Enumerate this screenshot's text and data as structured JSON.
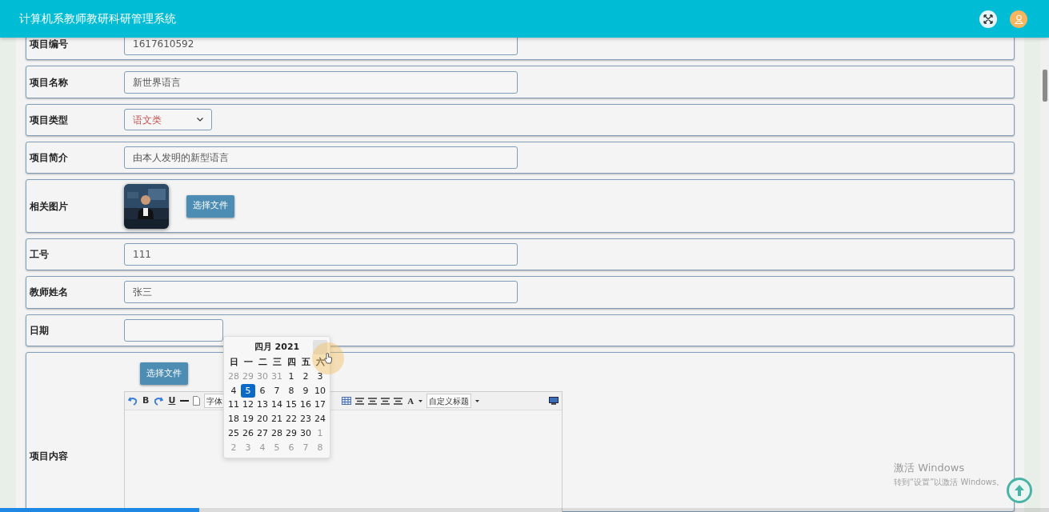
{
  "header": {
    "title": "计算机系教师教研科研管理系统"
  },
  "form": [
    {
      "kind": "text",
      "label": "项目编号",
      "value": "1617610592"
    },
    {
      "kind": "text",
      "label": "项目名称",
      "value": "新世界语言"
    },
    {
      "kind": "select",
      "label": "项目类型",
      "value": "语文类"
    },
    {
      "kind": "text",
      "label": "项目简介",
      "value": "由本人发明的新型语言"
    },
    {
      "label": "相关图片",
      "button": "选择文件"
    },
    {
      "kind": "text",
      "label": "工号",
      "value": "111"
    },
    {
      "kind": "text",
      "label": "教师姓名",
      "value": "张三"
    },
    {
      "kind": "date",
      "label": "日期",
      "calendar": {
        "title": "四月 2021",
        "weekdays": [
          "日",
          "一",
          "二",
          "三",
          "四",
          "五",
          "六"
        ],
        "weeks": [
          [
            {
              "day": "28",
              "muted": true,
              "selected": false
            },
            {
              "day": "29",
              "muted": true,
              "selected": false
            },
            {
              "day": "30",
              "muted": true,
              "selected": false
            },
            {
              "day": "31",
              "muted": true,
              "selected": false
            },
            {
              "day": "1",
              "muted": false,
              "selected": false
            },
            {
              "day": "2",
              "muted": false,
              "selected": false
            },
            {
              "day": "3",
              "muted": false,
              "selected": false
            }
          ],
          [
            {
              "day": "4",
              "muted": false,
              "selected": false
            },
            {
              "day": "5",
              "muted": false,
              "selected": true
            },
            {
              "day": "6",
              "muted": false,
              "selected": false
            },
            {
              "day": "7",
              "muted": false,
              "selected": false
            },
            {
              "day": "8",
              "muted": false,
              "selected": false
            },
            {
              "day": "9",
              "muted": false,
              "selected": false
            },
            {
              "day": "10",
              "muted": false,
              "selected": false
            }
          ],
          [
            {
              "day": "11",
              "muted": false,
              "selected": false
            },
            {
              "day": "12",
              "muted": false,
              "selected": false
            },
            {
              "day": "13",
              "muted": false,
              "selected": false
            },
            {
              "day": "14",
              "muted": false,
              "selected": false
            },
            {
              "day": "15",
              "muted": false,
              "selected": false
            },
            {
              "day": "16",
              "muted": false,
              "selected": false
            },
            {
              "day": "17",
              "muted": false,
              "selected": false
            }
          ],
          [
            {
              "day": "18",
              "muted": false,
              "selected": false
            },
            {
              "day": "19",
              "muted": false,
              "selected": false
            },
            {
              "day": "20",
              "muted": false,
              "selected": false
            },
            {
              "day": "21",
              "muted": false,
              "selected": false
            },
            {
              "day": "22",
              "muted": false,
              "selected": false
            },
            {
              "day": "23",
              "muted": false,
              "selected": false
            },
            {
              "day": "24",
              "muted": false,
              "selected": false
            }
          ],
          [
            {
              "day": "25",
              "muted": false,
              "selected": false
            },
            {
              "day": "26",
              "muted": false,
              "selected": false
            },
            {
              "day": "27",
              "muted": false,
              "selected": false
            },
            {
              "day": "28",
              "muted": false,
              "selected": false
            },
            {
              "day": "29",
              "muted": false,
              "selected": false
            },
            {
              "day": "30",
              "muted": false,
              "selected": false
            },
            {
              "day": "1",
              "muted": true,
              "selected": false
            }
          ],
          [
            {
              "day": "2",
              "muted": true,
              "selected": false
            },
            {
              "day": "3",
              "muted": true,
              "selected": false
            },
            {
              "day": "4",
              "muted": true,
              "selected": false
            },
            {
              "day": "5",
              "muted": true,
              "selected": false
            },
            {
              "day": "6",
              "muted": true,
              "selected": false
            },
            {
              "day": "7",
              "muted": true,
              "selected": false
            },
            {
              "day": "8",
              "muted": true,
              "selected": false
            }
          ]
        ]
      }
    },
    {
      "kind": "editor",
      "label": "项目内容",
      "button": "选择文件",
      "toolbar": [
        {
          "kind": "undo"
        },
        {
          "kind": "bold",
          "text": "B"
        },
        {
          "kind": "redo"
        },
        {
          "kind": "underline",
          "text": "U"
        },
        {
          "kind": "rule"
        },
        {
          "kind": "page"
        },
        {
          "kind": "select",
          "text": "字体"
        },
        {
          "kind": "gap"
        },
        {
          "kind": "table"
        },
        {
          "kind": "align"
        },
        {
          "kind": "align"
        },
        {
          "kind": "align"
        },
        {
          "kind": "align"
        },
        {
          "kind": "color",
          "text": "A"
        },
        {
          "kind": "caret"
        },
        {
          "kind": "select",
          "text": "自定义标题"
        },
        {
          "kind": "caret"
        },
        {
          "kind": "spacer"
        },
        {
          "kind": "fullscreen"
        }
      ]
    }
  ],
  "activation": {
    "title": "激活 Windows",
    "subtitle": "转到“设置”以激活 Windows。"
  },
  "player": {
    "level": 0.19
  }
}
